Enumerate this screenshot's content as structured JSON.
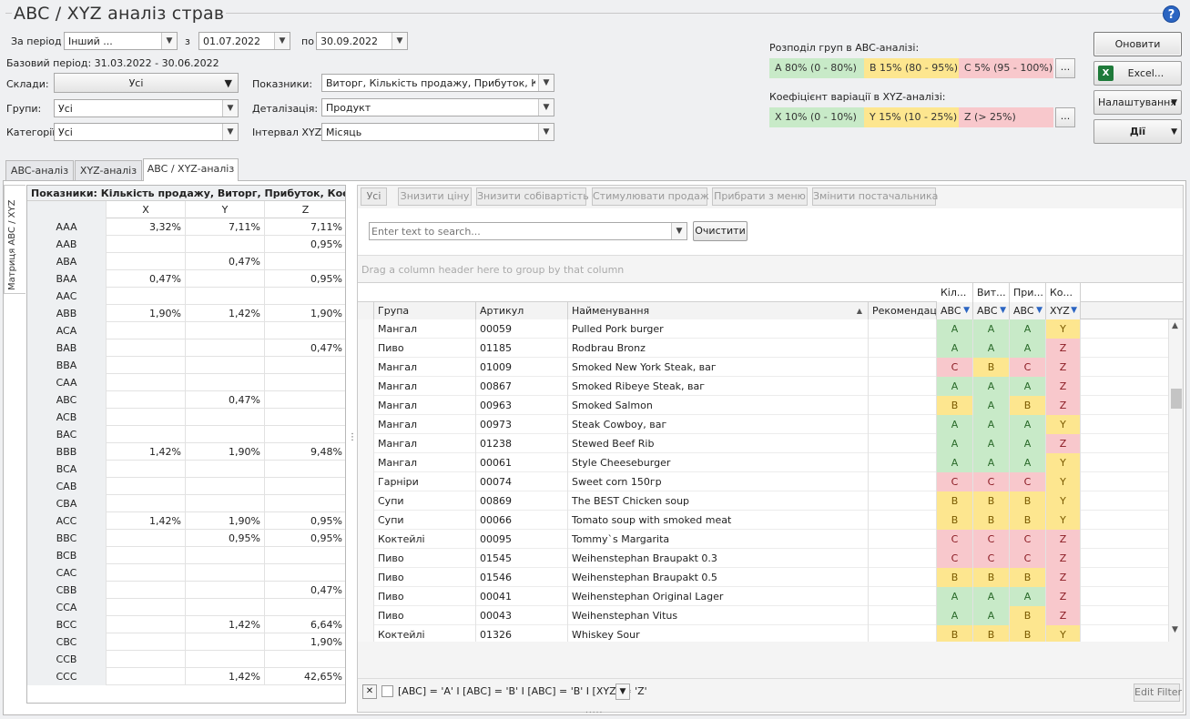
{
  "app": {
    "title": "ABC / XYZ аналіз страв",
    "help": "?"
  },
  "filters": {
    "period_label": "За період",
    "period_value": "Інший ...",
    "from_label": "з",
    "from_value": "01.07.2022",
    "to_label": "по",
    "to_value": "30.09.2022",
    "base_period": "Базовий період: 31.03.2022 - 30.06.2022",
    "stores_label": "Склади:",
    "stores_value": "Усі",
    "groups_label": "Групи:",
    "groups_value": "Усі",
    "categories_label": "Категорії",
    "categories_value": "Усі",
    "indicators_label": "Показники:",
    "indicators_value": "Виторг, Кількість продажу, Прибуток, Кое...",
    "detail_label": "Деталізація:",
    "detail_value": "Продукт",
    "interval_label": "Інтервал XYZ:",
    "interval_value": "Місяць"
  },
  "abc_dist": {
    "label": "Розподіл груп в ABC-аналізі:",
    "a": "A 80% (0 - 80%)",
    "b": "B 15% (80 - 95%)",
    "c": "C 5% (95 - 100%)",
    "more": "..."
  },
  "xyz_var": {
    "label": "Коефіцієнт варіації в XYZ-аналізі:",
    "x": "X 10% (0 - 10%)",
    "y": "Y 15% (10 - 25%)",
    "z": "Z  (> 25%)",
    "more": "..."
  },
  "actions": {
    "refresh": "Оновити",
    "excel": "Excel...",
    "settings": "Налаштування",
    "actions": "Дії"
  },
  "colors": {
    "a": "#c8eac8",
    "b": "#fde68f",
    "c": "#f8c8cc"
  },
  "tabs": [
    "ABC-аналіз",
    "XYZ-аналіз",
    "ABC / XYZ-аналіз"
  ],
  "matrix": {
    "side_tab": "Матриця ABC / XYZ",
    "header": "Показники: Кількість продажу, Виторг, Прибуток, Коефіціє",
    "cols": [
      "X",
      "Y",
      "Z"
    ],
    "rows": [
      {
        "k": "AAA",
        "x": "3,32%",
        "y": "7,11%",
        "z": "7,11%"
      },
      {
        "k": "AAB",
        "x": "",
        "y": "",
        "z": "0,95%"
      },
      {
        "k": "ABA",
        "x": "",
        "y": "0,47%",
        "z": ""
      },
      {
        "k": "BAA",
        "x": "0,47%",
        "y": "",
        "z": "0,95%"
      },
      {
        "k": "AAC",
        "x": "",
        "y": "",
        "z": ""
      },
      {
        "k": "ABB",
        "x": "1,90%",
        "y": "1,42%",
        "z": "1,90%"
      },
      {
        "k": "ACA",
        "x": "",
        "y": "",
        "z": ""
      },
      {
        "k": "BAB",
        "x": "",
        "y": "",
        "z": "0,47%"
      },
      {
        "k": "BBA",
        "x": "",
        "y": "",
        "z": ""
      },
      {
        "k": "CAA",
        "x": "",
        "y": "",
        "z": ""
      },
      {
        "k": "ABC",
        "x": "",
        "y": "0,47%",
        "z": ""
      },
      {
        "k": "ACB",
        "x": "",
        "y": "",
        "z": ""
      },
      {
        "k": "BAC",
        "x": "",
        "y": "",
        "z": ""
      },
      {
        "k": "BBB",
        "x": "1,42%",
        "y": "1,90%",
        "z": "9,48%"
      },
      {
        "k": "BCA",
        "x": "",
        "y": "",
        "z": ""
      },
      {
        "k": "CAB",
        "x": "",
        "y": "",
        "z": ""
      },
      {
        "k": "CBA",
        "x": "",
        "y": "",
        "z": ""
      },
      {
        "k": "ACC",
        "x": "1,42%",
        "y": "1,90%",
        "z": "0,95%"
      },
      {
        "k": "BBC",
        "x": "",
        "y": "0,95%",
        "z": "0,95%"
      },
      {
        "k": "BCB",
        "x": "",
        "y": "",
        "z": ""
      },
      {
        "k": "CAC",
        "x": "",
        "y": "",
        "z": ""
      },
      {
        "k": "CBB",
        "x": "",
        "y": "",
        "z": "0,47%"
      },
      {
        "k": "CCA",
        "x": "",
        "y": "",
        "z": ""
      },
      {
        "k": "BCC",
        "x": "",
        "y": "1,42%",
        "z": "6,64%"
      },
      {
        "k": "CBC",
        "x": "",
        "y": "",
        "z": "1,90%"
      },
      {
        "k": "CCB",
        "x": "",
        "y": "",
        "z": ""
      },
      {
        "k": "CCC",
        "x": "",
        "y": "1,42%",
        "z": "42,65%"
      }
    ]
  },
  "toolbar": [
    "Усі",
    "Знизити ціну",
    "Знизити собівартість",
    "Стимулювати продаж",
    "Прибрати з меню",
    "Змінити постачальника"
  ],
  "search": {
    "placeholder": "Enter text to search...",
    "clear": "Очистити"
  },
  "group_hint": "Drag a column header here to group by that column",
  "grid": {
    "top_headers": [
      "Кіл...",
      "Вит...",
      "При...",
      "Ко..."
    ],
    "headers": [
      "Група",
      "Артикул",
      "Найменування",
      "Рекомендації",
      "ABC",
      "ABC",
      "ABC",
      "XYZ"
    ],
    "rows": [
      [
        "Мангал",
        "00059",
        "Pulled Pork burger",
        "",
        "A",
        "A",
        "A",
        "Y"
      ],
      [
        "Пиво",
        "01185",
        "Rodbrau Bronz",
        "",
        "A",
        "A",
        "A",
        "Z"
      ],
      [
        "Мангал",
        "01009",
        "Smoked New York Steak, ваг",
        "",
        "C",
        "B",
        "C",
        "Z"
      ],
      [
        "Мангал",
        "00867",
        "Smoked Ribeye Steak, ваг",
        "",
        "A",
        "A",
        "A",
        "Z"
      ],
      [
        "Мангал",
        "00963",
        "Smoked Salmon",
        "",
        "B",
        "A",
        "B",
        "Z"
      ],
      [
        "Мангал",
        "00973",
        "Steak Cowboy, ваг",
        "",
        "A",
        "A",
        "A",
        "Y"
      ],
      [
        "Мангал",
        "01238",
        "Stewed Beef Rib",
        "",
        "A",
        "A",
        "A",
        "Z"
      ],
      [
        "Мангал",
        "00061",
        "Style Cheeseburger",
        "",
        "A",
        "A",
        "A",
        "Y"
      ],
      [
        "Гарніри",
        "00074",
        "Sweet corn  150гр",
        "",
        "C",
        "C",
        "C",
        "Y"
      ],
      [
        "Супи",
        "00869",
        "The BEST Chicken soup",
        "",
        "B",
        "B",
        "B",
        "Y"
      ],
      [
        "Супи",
        "00066",
        "Tomato soup with smoked meat",
        "",
        "B",
        "B",
        "B",
        "Y"
      ],
      [
        "Коктейлі",
        "00095",
        "Tommy`s Margarita",
        "",
        "C",
        "C",
        "C",
        "Z"
      ],
      [
        "Пиво",
        "01545",
        "Weihenstephan Braupakt 0.3",
        "",
        "C",
        "C",
        "C",
        "Z"
      ],
      [
        "Пиво",
        "01546",
        "Weihenstephan Braupakt 0.5",
        "",
        "B",
        "B",
        "B",
        "Z"
      ],
      [
        "Пиво",
        "00041",
        "Weihenstephan Original Lager",
        "",
        "A",
        "A",
        "A",
        "Z"
      ],
      [
        "Пиво",
        "00043",
        "Weihenstephan Vitus",
        "",
        "A",
        "A",
        "B",
        "Z"
      ],
      [
        "Коктейлі",
        "01326",
        "Whiskey Sour",
        "",
        "B",
        "B",
        "B",
        "Y"
      ]
    ]
  },
  "filter_bar": {
    "expr": "[ABC] = 'A' I [ABC] = 'B' I [ABC] = 'B' I [XYZ] = 'Z'",
    "edit": "Edit Filter",
    "close": "✕"
  }
}
